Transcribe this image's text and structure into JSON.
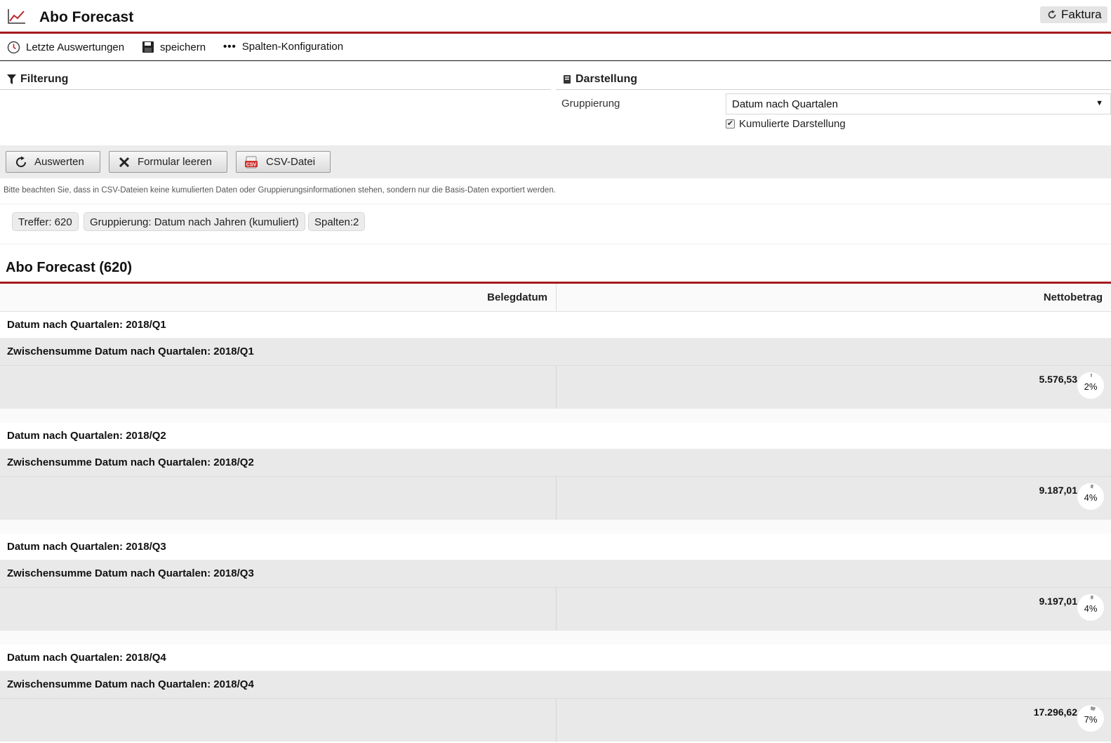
{
  "header": {
    "title": "Abo Forecast",
    "faktura_label": "Faktura"
  },
  "toolbar": {
    "recent_label": "Letzte Auswertungen",
    "save_label": "speichern",
    "columns_label": "Spalten-Konfiguration"
  },
  "filter": {
    "title": "Filterung"
  },
  "display": {
    "title": "Darstellung",
    "grouping_label": "Gruppierung",
    "grouping_value": "Datum nach Quartalen",
    "cumulative_label": "Kumulierte Darstellung",
    "cumulative_checked": true
  },
  "buttons": {
    "evaluate": "Auswerten",
    "clear": "Formular leeren",
    "csv": "CSV-Datei"
  },
  "note": "Bitte beachten Sie, dass in CSV-Dateien keine kumulierten Daten oder Gruppierungsinformationen stehen, sondern nur die Basis-Daten exportiert werden.",
  "badges": {
    "hits": "Treffer: 620",
    "grouping": "Gruppierung: Datum nach Jahren (kumuliert)",
    "columns": "Spalten:2"
  },
  "report": {
    "title": "Abo Forecast (620)",
    "columns": [
      "Belegdatum",
      "Nettobetrag"
    ],
    "groups": [
      {
        "label": "Datum nach Quartalen: 2018/Q1",
        "subtotal_label": "Zwischensumme Datum nach Quartalen: 2018/Q1",
        "amount": "5.576,53",
        "percent_label": "2%",
        "percent": 2
      },
      {
        "label": "Datum nach Quartalen: 2018/Q2",
        "subtotal_label": "Zwischensumme Datum nach Quartalen: 2018/Q2",
        "amount": "9.187,01",
        "percent_label": "4%",
        "percent": 4
      },
      {
        "label": "Datum nach Quartalen: 2018/Q3",
        "subtotal_label": "Zwischensumme Datum nach Quartalen: 2018/Q3",
        "amount": "9.197,01",
        "percent_label": "4%",
        "percent": 4
      },
      {
        "label": "Datum nach Quartalen: 2018/Q4",
        "subtotal_label": "Zwischensumme Datum nach Quartalen: 2018/Q4",
        "amount": "17.296,62",
        "percent_label": "7%",
        "percent": 7
      }
    ]
  },
  "colors": {
    "accent": "#a31c1f",
    "subtotal_bg": "#e9e9e9"
  }
}
